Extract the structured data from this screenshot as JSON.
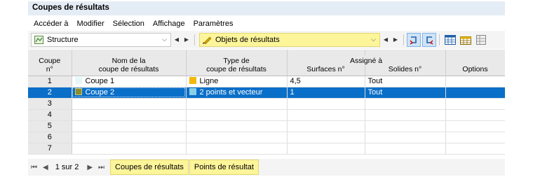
{
  "window": {
    "title": "Coupes de résultats"
  },
  "menu": [
    "Accéder à",
    "Modifier",
    "Sélection",
    "Affichage",
    "Paramètres"
  ],
  "toolbar": {
    "combo1": {
      "value": "Structure",
      "icon": "structure-icon"
    },
    "combo2": {
      "value": "Objets de résultats",
      "icon": "pencil-icon"
    }
  },
  "table": {
    "headers": {
      "col_no": [
        "Coupe",
        "n°"
      ],
      "col_name": [
        "Nom de la",
        "coupe de résultats"
      ],
      "col_type": [
        "Type de",
        "coupe de résultats"
      ],
      "group_assigned": "Assigné à",
      "col_surfaces": "Surfaces n°",
      "col_solids": "Solides n°",
      "col_options": "Options"
    },
    "rows": [
      {
        "no": "1",
        "name": "Coupe 1",
        "name_color": "#e6f7fb",
        "type": "Ligne",
        "type_color": "#f2b90c",
        "surfaces": "4,5",
        "solids": "Tout",
        "options": ""
      },
      {
        "no": "2",
        "name": "Coupe 2",
        "name_color": "#8d8d2e",
        "type": "2 points et vecteur",
        "type_color": "#8ccfe8",
        "surfaces": "1",
        "solids": "Tout",
        "options": ""
      },
      {
        "no": "3",
        "name": "",
        "type": "",
        "surfaces": "",
        "solids": "",
        "options": ""
      },
      {
        "no": "4",
        "name": "",
        "type": "",
        "surfaces": "",
        "solids": "",
        "options": ""
      },
      {
        "no": "5",
        "name": "",
        "type": "",
        "surfaces": "",
        "solids": "",
        "options": ""
      },
      {
        "no": "6",
        "name": "",
        "type": "",
        "surfaces": "",
        "solids": "",
        "options": ""
      },
      {
        "no": "7",
        "name": "",
        "type": "",
        "surfaces": "",
        "solids": "",
        "options": ""
      }
    ],
    "selected_row": "2"
  },
  "pager": {
    "text": "1 sur 2"
  },
  "tabs": [
    "Coupes de résultats",
    "Points de résultat"
  ],
  "colors": {
    "selection": "#0a6fc8",
    "tab_highlight": "#fdf59a",
    "header_bg": "#e9e9e9"
  }
}
